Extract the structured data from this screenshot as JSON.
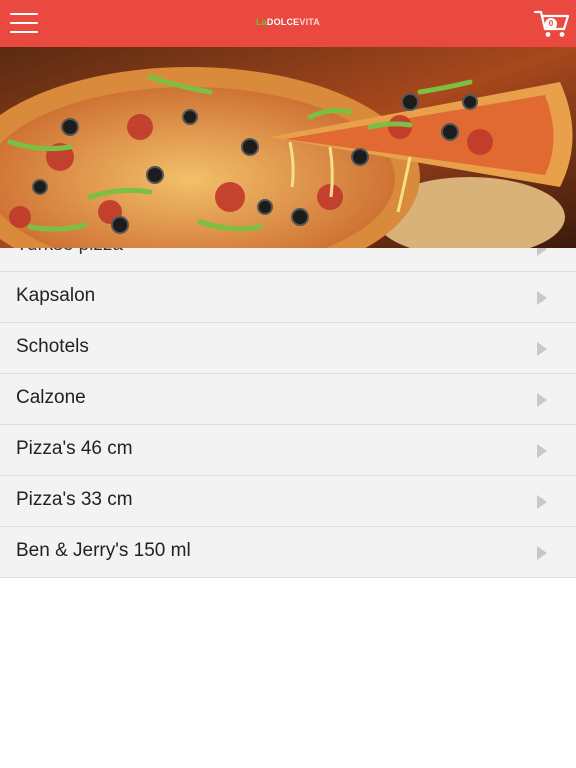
{
  "header": {
    "logo_part1": "La",
    "logo_part2": "DOLCE",
    "logo_part3": "VITA",
    "cart_count": "0",
    "icons": {
      "menu": "hamburger-menu-icon",
      "cart": "shopping-cart-icon"
    }
  },
  "hero": {
    "image": "pizza-photo"
  },
  "categories": [
    {
      "label": "Turkse pizza"
    },
    {
      "label": "Kapsalon"
    },
    {
      "label": "Schotels"
    },
    {
      "label": "Calzone"
    },
    {
      "label": "Pizza's 46 cm"
    },
    {
      "label": "Pizza's 33 cm"
    },
    {
      "label": "Ben & Jerry's 150 ml"
    }
  ],
  "colors": {
    "brand": "#e9493f",
    "row_bg": "#f3f3f3",
    "separator": "#dcdcdc",
    "chevron": "#c8c8c8"
  }
}
